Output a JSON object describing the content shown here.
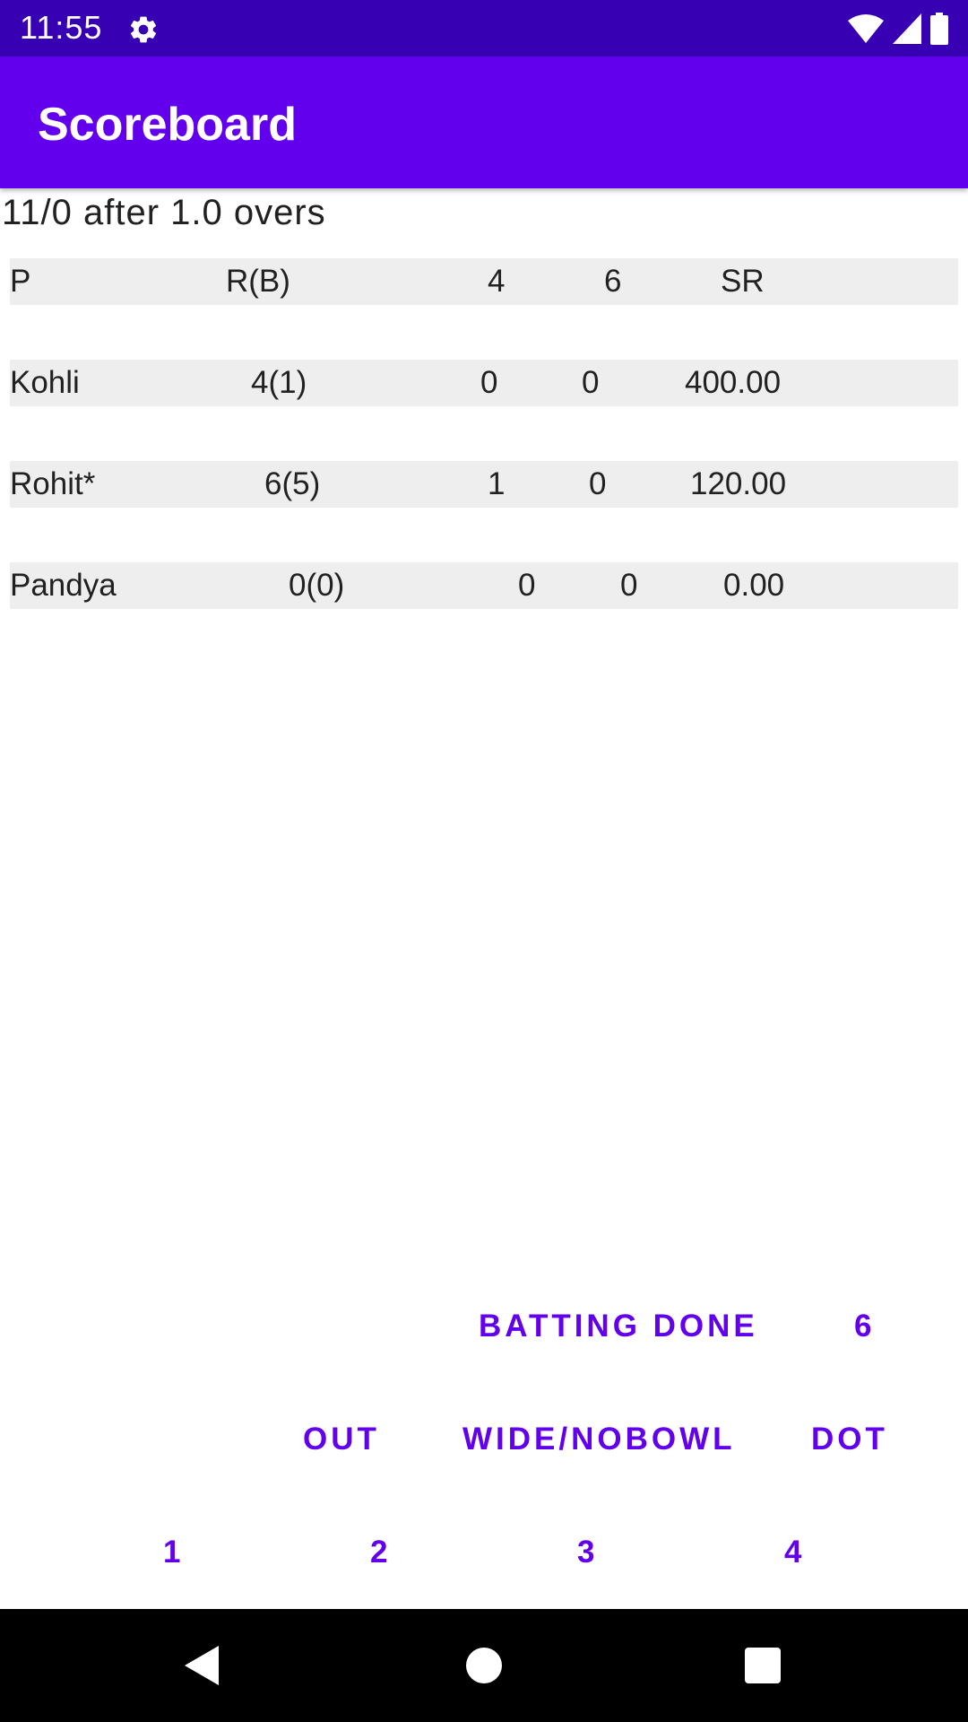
{
  "status_bar": {
    "time": "11:55",
    "icons": [
      "settings-icon",
      "wifi-icon",
      "cellular-signal-icon",
      "battery-icon"
    ]
  },
  "app_bar": {
    "title": "Scoreboard"
  },
  "summary": "11/0 after 1.0 overs",
  "table": {
    "headers": {
      "player": "P",
      "runs_balls": "R(B)",
      "fours": "4",
      "sixes": "6",
      "strike_rate": "SR"
    },
    "rows": [
      {
        "player": "Kohli",
        "runs_balls": "4(1)",
        "fours": "0",
        "sixes": "0",
        "strike_rate": "400.00"
      },
      {
        "player": "Rohit*",
        "runs_balls": "6(5)",
        "fours": "1",
        "sixes": "0",
        "strike_rate": "120.00"
      },
      {
        "player": "Pandya",
        "runs_balls": "0(0)",
        "fours": "0",
        "sixes": "0",
        "strike_rate": "0.00"
      }
    ]
  },
  "buttons": {
    "batting_done": "BATTING DONE",
    "six": "6",
    "out": "OUT",
    "wide_noball": "WIDE/NOBOWL",
    "dot": "DOT",
    "one": "1",
    "two": "2",
    "three": "3",
    "four": "4"
  },
  "colors": {
    "status_bar": "#3700b3",
    "app_bar": "#6200ee",
    "accent": "#6200ee",
    "row_background": "#eeeeee",
    "nav_bar": "#000000"
  },
  "nav_bar": {
    "icons": [
      "back-icon",
      "home-icon",
      "recents-icon"
    ]
  }
}
